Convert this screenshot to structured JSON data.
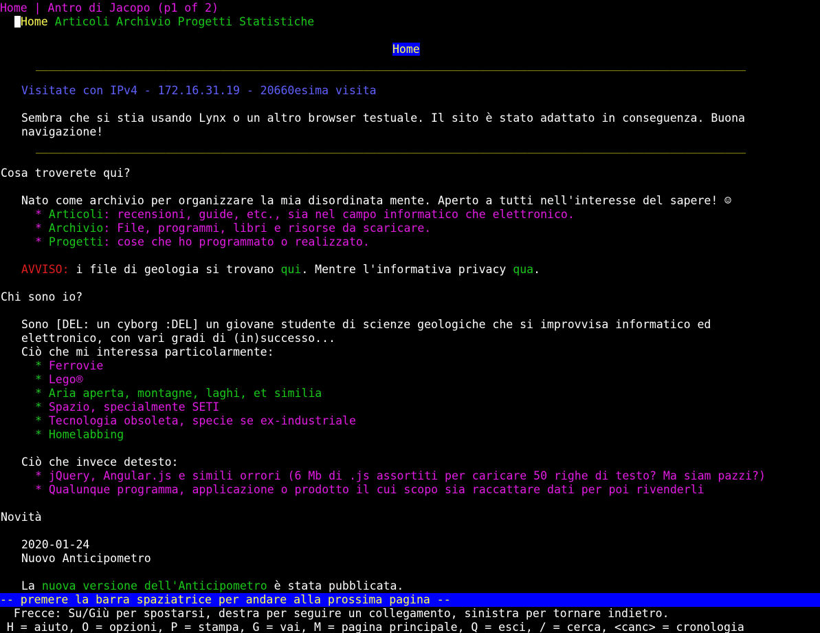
{
  "title_bar": "Home | Antro di Jacopo (p1 of 2)",
  "nav": [
    {
      "label": "Home",
      "current": true
    },
    {
      "label": "Articoli"
    },
    {
      "label": "Archivio"
    },
    {
      "label": "Progetti"
    },
    {
      "label": "Statistiche"
    }
  ],
  "page_heading": "Home",
  "rule": "________________________________________________________________________________________________________",
  "visit_line": "Visitate con IPv4 - 172.16.31.19 - 20660esima visita",
  "lynx_notice_1": "Sembra che si stia usando Lynx o un altro browser testuale. Il sito è stato adattato in conseguenza. Buona",
  "lynx_notice_2": "navigazione!",
  "section1": {
    "heading": "Cosa troverete qui?",
    "intro": "Nato come archivio per organizzare la mia disordinata mente. Aperto a tutti nell'interesse del sapere! ☺",
    "items": [
      {
        "label": "Articoli",
        "text": ": recensioni, guide, etc., sia nel campo informatico che elettronico."
      },
      {
        "label": "Archivio",
        "text": ": File, programmi, libri e risorse da scaricare."
      },
      {
        "label": "Progetti",
        "text": ": cose che ho programmato o realizzato."
      }
    ],
    "notice_label": "AVVISO:",
    "notice_text1": " i file di geologia si trovano ",
    "notice_link1": "qui",
    "notice_text2": ". Mentre l'informativa privacy ",
    "notice_link2": "qua",
    "notice_text3": "."
  },
  "section2": {
    "heading": "Chi sono io?",
    "bio_1": "Sono [DEL: un cyborg :DEL] un giovane studente di scienze geologiche che si improvvisa informatico ed",
    "bio_2": "elettronico, con vari gradi di (in)successo...",
    "likes_heading": "Ciò che mi interessa particolarmente:",
    "likes": [
      {
        "text": "Ferrovie",
        "color": "magenta"
      },
      {
        "text": "Lego®",
        "color": "magenta"
      },
      {
        "text": "Aria aperta, montagne, laghi, et similia",
        "color": "green"
      },
      {
        "text": "Spazio, specialmente SETI",
        "color": "magenta"
      },
      {
        "text": "Tecnologia obsoleta, specie se ex-industriale",
        "color": "magenta"
      },
      {
        "text": "Homelabbing",
        "color": "green"
      }
    ],
    "dislikes_heading": "Ciò che invece detesto:",
    "dislikes": [
      "jQuery, Angular.js e simili orrori (6 Mb di .js assortiti per caricare 50 righe di testo? Ma siam pazzi?)",
      "Qualunque programma, applicazione o prodotto il cui scopo sia raccattare dati per poi rivenderli"
    ]
  },
  "section3": {
    "heading": "Novità",
    "date": "2020-01-24",
    "title": "Nuovo Anticipometro",
    "text_before": "La ",
    "link": "nuova versione dell'Anticipometro",
    "text_after": " è stata pubblicata."
  },
  "status_bar": "-- premere la barra spaziatrice per andare alla prossima pagina --",
  "help_line_1": "  Frecce: Su/Giù per spostarsi, destra per seguire un collegamento, sinistra per tornare indietro.",
  "help_line_2": " H = aiuto, O = opzioni, P = stampa, G = vai, M = pagina principale, Q = esci, / = cerca, <canc> = cronologia",
  "bullet": "*",
  "colors": {
    "background": "#000000",
    "text": "#ffffff",
    "link": "#19c819",
    "link_visited": "#e31ce3",
    "heading": "#ffff54",
    "status_bg": "#0000ff",
    "info": "#6060ff",
    "warning": "#e01e1e"
  }
}
